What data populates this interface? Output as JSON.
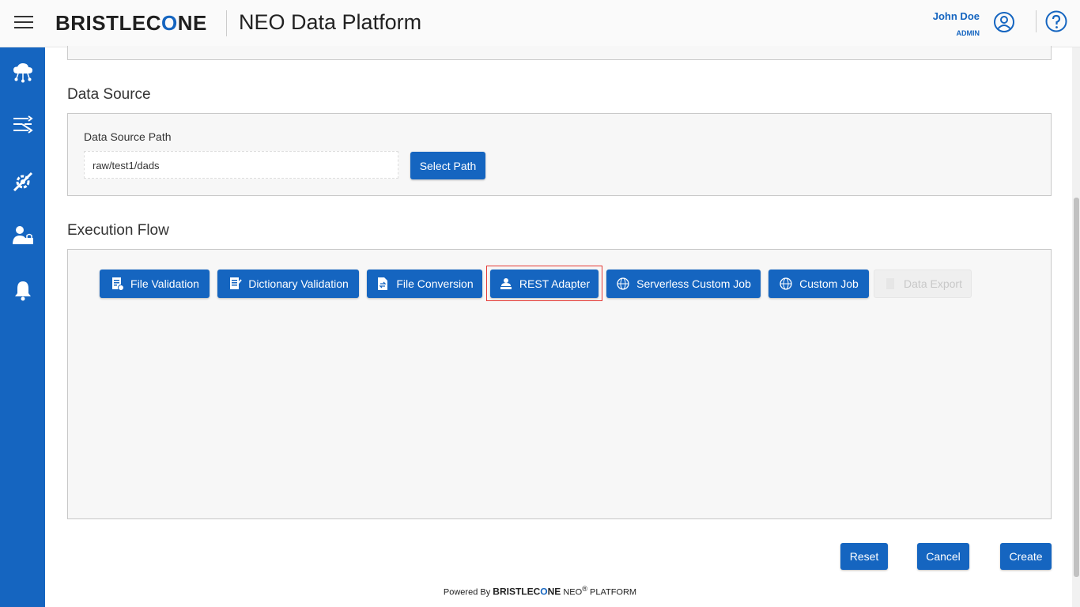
{
  "header": {
    "brand": "BRISTLECONE",
    "app_title": "NEO Data Platform",
    "user_name": "John Doe",
    "user_role": "ADMIN"
  },
  "sidebar": {
    "items": [
      {
        "icon": "cloud-network-icon"
      },
      {
        "icon": "pipeline-icon"
      },
      {
        "icon": "settings-tools-icon"
      },
      {
        "icon": "user-admin-icon"
      },
      {
        "icon": "bell-icon"
      }
    ]
  },
  "data_source": {
    "title": "Data Source",
    "path_label": "Data Source Path",
    "path_value": "raw/test1/dads",
    "select_label": "Select Path"
  },
  "execution_flow": {
    "title": "Execution Flow",
    "buttons": [
      {
        "label": "File Validation",
        "icon": "file-validation-icon"
      },
      {
        "label": "Dictionary Validation",
        "icon": "dictionary-icon"
      },
      {
        "label": "File Conversion",
        "icon": "file-conversion-icon"
      },
      {
        "label": "REST Adapter",
        "icon": "rest-adapter-icon"
      },
      {
        "label": "Serverless Custom Job",
        "icon": "globe-icon"
      },
      {
        "label": "Custom Job",
        "icon": "globe-icon"
      },
      {
        "label": "Data Export",
        "icon": "export-icon"
      }
    ]
  },
  "actions": {
    "reset": "Reset",
    "cancel": "Cancel",
    "create": "Create"
  },
  "footer": {
    "powered_by": "Powered By",
    "brand": "BRISTLECONE",
    "neo": "NEO",
    "reg": "®",
    "platform": "PLATFORM"
  },
  "colors": {
    "primary": "#1565c0",
    "highlight": "#e53935"
  }
}
